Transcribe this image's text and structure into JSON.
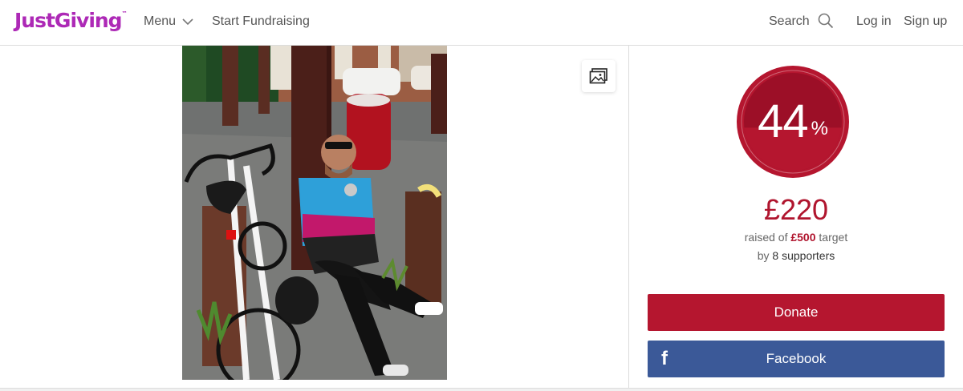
{
  "header": {
    "logo": "JustGiving",
    "logo_tm": "™",
    "menu_label": "Menu",
    "start_fundraising": "Start Fundraising",
    "search_label": "Search",
    "login": "Log in",
    "signup": "Sign up"
  },
  "donation": {
    "percent": "44",
    "percent_unit": "%",
    "progress_fraction": 0.44,
    "raised": "£220",
    "raised_prefix": "raised of",
    "target": "£500",
    "target_suffix": "target",
    "by_prefix": "by",
    "supporters": "8 supporters",
    "donate_label": "Donate",
    "facebook_label": "Facebook",
    "facebook_icon": "f"
  },
  "colors": {
    "brand": "#ad29b6",
    "donate": "#b5162f",
    "facebook": "#3b5998",
    "progress_dark": "#9c0f27",
    "progress_fill": "#b5162f"
  }
}
